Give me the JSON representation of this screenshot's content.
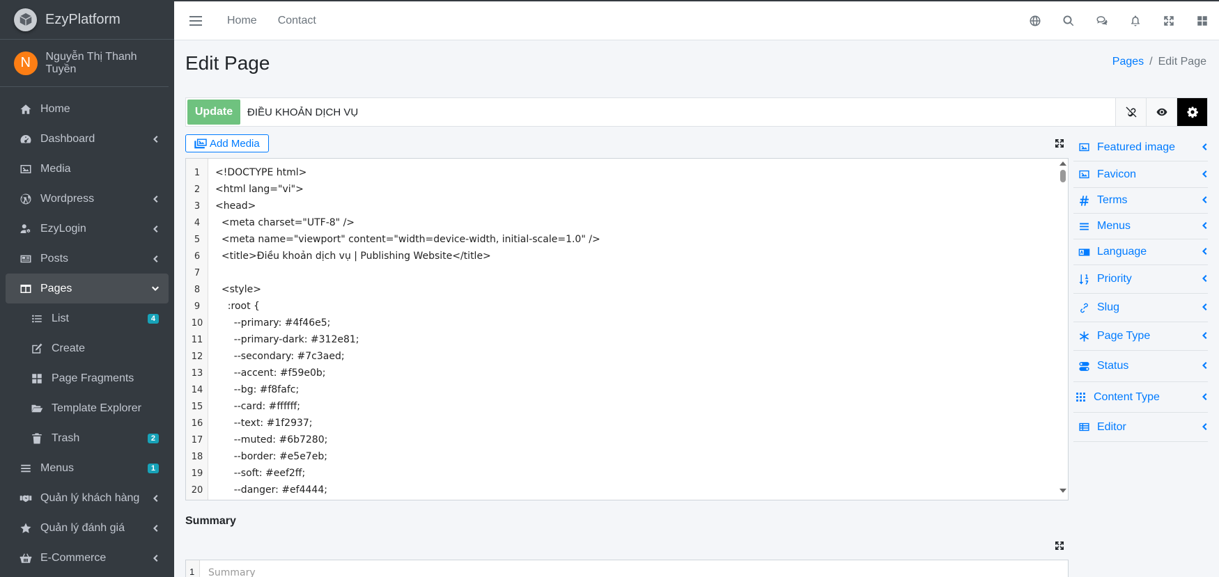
{
  "brand": {
    "name": "EzyPlatform"
  },
  "user": {
    "initial": "N",
    "name": "Nguyễn Thị Thanh Tuyền"
  },
  "sidebar": {
    "items": [
      {
        "label": "Home",
        "icon": "home-icon"
      },
      {
        "label": "Dashboard",
        "icon": "dashboard-icon"
      },
      {
        "label": "Media",
        "icon": "image-icon"
      },
      {
        "label": "Wordpress",
        "icon": "wordpress-icon"
      },
      {
        "label": "EzyLogin",
        "icon": "users-cog-icon"
      },
      {
        "label": "Posts",
        "icon": "newspaper-icon"
      },
      {
        "label": "Pages",
        "icon": "columns-icon"
      },
      {
        "label": "List",
        "icon": "list-icon",
        "badge": "4"
      },
      {
        "label": "Create",
        "icon": "edit-icon"
      },
      {
        "label": "Page Fragments",
        "icon": "th-large-icon"
      },
      {
        "label": "Template Explorer",
        "icon": "folder-open-icon"
      },
      {
        "label": "Trash",
        "icon": "trash-icon",
        "badge": "2"
      },
      {
        "label": "Menus",
        "icon": "bars-icon",
        "badge": "1"
      },
      {
        "label": "Quản lý khách hàng",
        "icon": "handshake-icon"
      },
      {
        "label": "Quản lý đánh giá",
        "icon": "star-icon"
      },
      {
        "label": "E-Commerce",
        "icon": "shopping-basket-icon"
      }
    ]
  },
  "navbar": {
    "home": "Home",
    "contact": "Contact"
  },
  "page": {
    "title": "Edit Page",
    "breadcrumb_parent": "Pages",
    "breadcrumb_sep": "/",
    "breadcrumb_current": "Edit Page"
  },
  "toolbar": {
    "update_label": "Update",
    "title_value": "ĐIỀU KHOẢN DỊCH VỤ",
    "add_media_label": "Add Media"
  },
  "code": {
    "lines": [
      {
        "n": "1",
        "text": "<!DOCTYPE html>"
      },
      {
        "n": "2",
        "text": "<html lang=\"vi\">"
      },
      {
        "n": "3",
        "text": "<head>"
      },
      {
        "n": "4",
        "text": "  <meta charset=\"UTF-8\" />"
      },
      {
        "n": "5",
        "text": "  <meta name=\"viewport\" content=\"width=device-width, initial-scale=1.0\" />"
      },
      {
        "n": "6",
        "text": "  <title>Điều khoản dịch vụ | Publishing Website</title>"
      },
      {
        "n": "7",
        "text": ""
      },
      {
        "n": "8",
        "text": "  <style>"
      },
      {
        "n": "9",
        "text": "    :root {"
      },
      {
        "n": "10",
        "text": "      --primary: #4f46e5;"
      },
      {
        "n": "11",
        "text": "      --primary-dark: #312e81;"
      },
      {
        "n": "12",
        "text": "      --secondary: #7c3aed;"
      },
      {
        "n": "13",
        "text": "      --accent: #f59e0b;"
      },
      {
        "n": "14",
        "text": "      --bg: #f8fafc;"
      },
      {
        "n": "15",
        "text": "      --card: #ffffff;"
      },
      {
        "n": "16",
        "text": "      --text: #1f2937;"
      },
      {
        "n": "17",
        "text": "      --muted: #6b7280;"
      },
      {
        "n": "18",
        "text": "      --border: #e5e7eb;"
      },
      {
        "n": "19",
        "text": "      --soft: #eef2ff;"
      },
      {
        "n": "20",
        "text": "      --danger: #ef4444;"
      }
    ]
  },
  "summary": {
    "label": "Summary",
    "line_number": "1",
    "placeholder": "Summary"
  },
  "rpanel": {
    "items": [
      {
        "label": "Featured image",
        "icon": "image-icon"
      },
      {
        "label": "Favicon",
        "icon": "image-icon"
      },
      {
        "label": "Terms",
        "icon": "hashtag-icon"
      },
      {
        "label": "Menus",
        "icon": "bars-icon"
      },
      {
        "label": "Language",
        "icon": "language-icon"
      },
      {
        "label": "Priority",
        "icon": "sort-numeric-icon"
      },
      {
        "label": "Slug",
        "icon": "link-icon"
      },
      {
        "label": "Page Type",
        "icon": "asterisk-icon"
      },
      {
        "label": "Status",
        "icon": "toggle-icon"
      },
      {
        "label": "Content Type",
        "icon": "grid-icon"
      },
      {
        "label": "Editor",
        "icon": "table-list-icon"
      }
    ]
  },
  "colors": {
    "sidebar_bg": "#343a40",
    "accent": "#007bff",
    "update_button": "#6fc27f",
    "badge": "#17a2b8",
    "avatar": "#fd7e14"
  }
}
